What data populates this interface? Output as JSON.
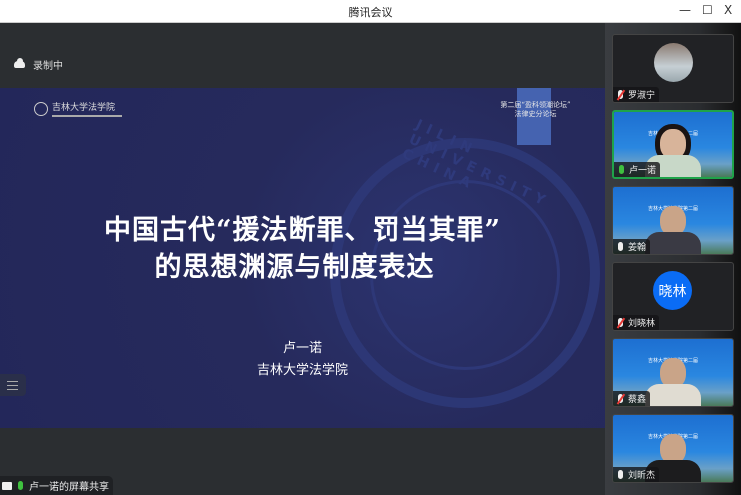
{
  "window": {
    "title": "腾讯会议",
    "minimize": "—",
    "maximize": "☐",
    "close": "X"
  },
  "recording": {
    "label": "录制中",
    "icon": "cloud-icon"
  },
  "slide": {
    "logo_text": "吉林大学法学院",
    "forum_line1": "第二届“盈科领潮论坛”",
    "forum_line2": "法律史分论坛",
    "title_line1": "中国古代“援法断罪、罚当其罪”",
    "title_line2": "的思想渊源与制度表达",
    "author": "卢一诺",
    "affiliation": "吉林大学法学院",
    "seal_text": "JILIN UNIVERSITY CHINA",
    "colors": {
      "background": "#23275a",
      "accent": "#4563b0"
    }
  },
  "screen_share": {
    "label": "卢一诺的屏幕共享"
  },
  "participants": [
    {
      "name": "罗淑宁",
      "mic": "muted",
      "video": false,
      "avatar": "photo"
    },
    {
      "name": "卢一诺",
      "mic": "speaking",
      "video": true,
      "active": true
    },
    {
      "name": "姜翰",
      "mic": "on",
      "video": true
    },
    {
      "name": "刘晓林",
      "mic": "muted",
      "video": false,
      "avatar_text": "晓林"
    },
    {
      "name": "蔡鑫",
      "mic": "muted",
      "video": true
    },
    {
      "name": "刘昕杰",
      "mic": "on",
      "video": true
    }
  ],
  "video_bg_text": "吉林大学法学院第二届"
}
